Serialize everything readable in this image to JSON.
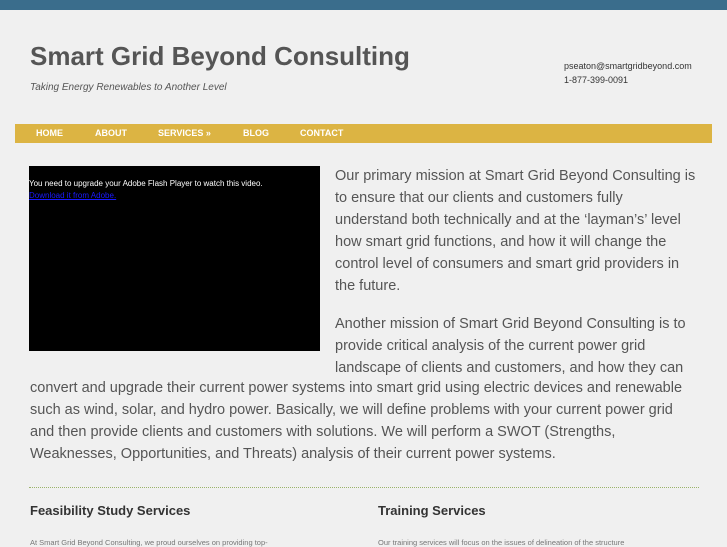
{
  "header": {
    "title": "Smart Grid Beyond Consulting",
    "tagline": "Taking Energy Renewables to Another Level",
    "email": "pseaton@smartgridbeyond.com",
    "phone": "1-877-399-0091"
  },
  "nav": {
    "items": [
      {
        "label": "HOME"
      },
      {
        "label": "ABOUT"
      },
      {
        "label": "SERVICES »"
      },
      {
        "label": "BLOG"
      },
      {
        "label": "CONTACT"
      }
    ]
  },
  "video": {
    "message": "You need to upgrade your Adobe Flash Player to watch this video.",
    "link": "Download it from Adobe."
  },
  "content": {
    "p1_lines": [
      "Our primary mission at Smart Grid Beyond Consulting is",
      "to ensure that our clients and customers fully",
      "understand both technically and at the ‘layman’s’ level",
      "how smart grid functions, and how it will change the",
      "control level of consumers and smart grid providers in",
      "the future."
    ],
    "p2_lines_narrow": [
      "Another mission of Smart Grid Beyond Consulting is to",
      "provide critical analysis of the current power grid",
      "landscape of clients and customers, and how they can"
    ],
    "p2_lines_wide": [
      "convert and upgrade their current power systems into smart grid using electric devices and renewable",
      "such as wind, solar, and hydro power. Basically, we will define problems with your current power grid",
      "and then provide clients and customers with solutions. We will perform a SWOT (Strengths,",
      "Weaknesses, Opportunities, and Threats) analysis of their current power systems."
    ]
  },
  "sections": [
    {
      "title": "Feasibility Study Services",
      "text": "At Smart Grid Beyond Consulting, we proud ourselves on providing top-"
    },
    {
      "title": "Training Services",
      "text": "Our training services will focus on the issues of delineation of the structure"
    }
  ],
  "colors": {
    "topbar": "#3a6d8c",
    "nav": "#dcb443",
    "divider": "#9bb36b"
  }
}
